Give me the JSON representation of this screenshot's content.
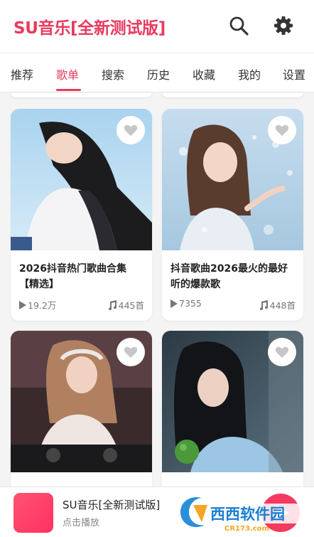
{
  "header": {
    "title": "SU音乐[全新测试版]",
    "search_icon": "search-icon",
    "settings_icon": "gear-icon"
  },
  "tabs": [
    {
      "label": "推荐",
      "active": false
    },
    {
      "label": "歌单",
      "active": true
    },
    {
      "label": "搜索",
      "active": false
    },
    {
      "label": "历史",
      "active": false
    },
    {
      "label": "收藏",
      "active": false
    },
    {
      "label": "我的",
      "active": false
    },
    {
      "label": "设置",
      "active": false
    }
  ],
  "playlists": [
    {
      "title": "2026抖音热门歌曲合集【精选】",
      "plays": "19.2万",
      "songs": "445首"
    },
    {
      "title": "抖音歌曲2026最火的最好听的爆款歌",
      "plays": "7355",
      "songs": "448首"
    },
    {
      "title": "",
      "plays": "",
      "songs": ""
    },
    {
      "title": "",
      "plays": "",
      "songs": ""
    }
  ],
  "player": {
    "title": "SU音乐[全新测试版]",
    "subtitle": "点击播放"
  },
  "watermark": {
    "text": "西西软件园",
    "url": "CR173.com"
  },
  "colors": {
    "accent": "#e83a5f",
    "text": "#222222",
    "muted": "#777777"
  }
}
